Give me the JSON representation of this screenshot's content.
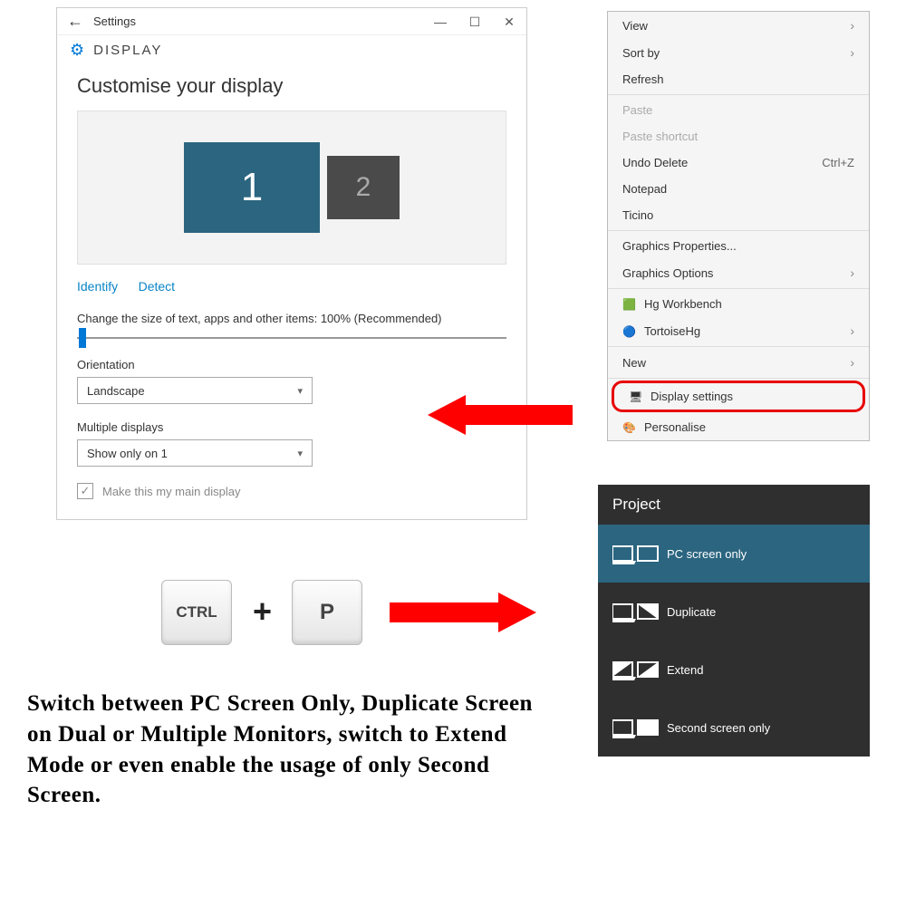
{
  "settings": {
    "window_title": "Settings",
    "header": "DISPLAY",
    "section_title": "Customise your display",
    "monitor1": "1",
    "monitor2": "2",
    "identify": "Identify",
    "detect": "Detect",
    "scale_label": "Change the size of text, apps and other items: 100% (Recommended)",
    "orientation_label": "Orientation",
    "orientation_value": "Landscape",
    "multiple_label": "Multiple displays",
    "multiple_value": "Show only on 1",
    "main_display": "Make this my main display"
  },
  "context_menu": {
    "view": "View",
    "sort": "Sort by",
    "refresh": "Refresh",
    "paste": "Paste",
    "paste_shortcut": "Paste shortcut",
    "undo": "Undo Delete",
    "undo_key": "Ctrl+Z",
    "notepad": "Notepad",
    "ticino": "Ticino",
    "gprops": "Graphics Properties...",
    "gopts": "Graphics Options",
    "hg": "Hg Workbench",
    "tortoise": "TortoiseHg",
    "new": "New",
    "display_settings": "Display settings",
    "personalise": "Personalise"
  },
  "keys": {
    "ctrl": "CTRL",
    "plus": "+",
    "p": "P"
  },
  "project": {
    "title": "Project",
    "pc_only": "PC screen only",
    "duplicate": "Duplicate",
    "extend": "Extend",
    "second_only": "Second screen only"
  },
  "caption": "Switch between PC Screen Only, Duplicate Screen on Dual or Multiple Monitors, switch to Extend Mode or even enable the usage of only Second Screen."
}
